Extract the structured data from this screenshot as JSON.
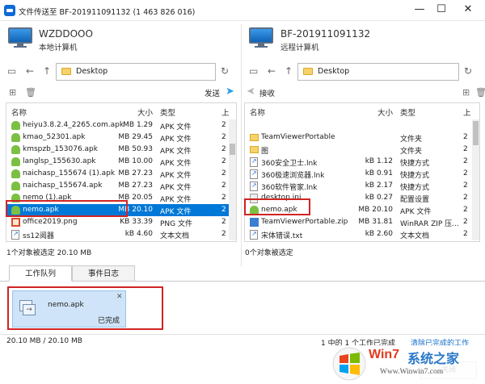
{
  "window": {
    "title": "文件传送至 BF-201911091132 (1 463 826 016)",
    "minimize": "—",
    "maximize": "☐",
    "close": "✕"
  },
  "local": {
    "name": "WZDDOOO",
    "subtitle": "本地计算机",
    "path": "Desktop",
    "send_label": "发送",
    "columns": {
      "name": "名称",
      "size": "大小",
      "type": "类型",
      "extra": "上"
    },
    "files": [
      {
        "name": "heiyu3.8.2.4_2265.com.apk",
        "size": "1.29 MB",
        "type": "APK 文件",
        "extra": "2",
        "icon": "apk"
      },
      {
        "name": "kmao_52301.apk",
        "size": "29.45 MB",
        "type": "APK 文件",
        "extra": "2",
        "icon": "apk"
      },
      {
        "name": "kmspzb_153076.apk",
        "size": "50.93 MB",
        "type": "APK 文件",
        "extra": "2",
        "icon": "apk"
      },
      {
        "name": "langlsp_155630.apk",
        "size": "10.00 MB",
        "type": "APK 文件",
        "extra": "2",
        "icon": "apk"
      },
      {
        "name": "naichasp_155674 (1).apk",
        "size": "27.23 MB",
        "type": "APK 文件",
        "extra": "2",
        "icon": "apk"
      },
      {
        "name": "naichasp_155674.apk",
        "size": "27.23 MB",
        "type": "APK 文件",
        "extra": "2",
        "icon": "apk"
      },
      {
        "name": "nemo (1).apk",
        "size": "20.05 MB",
        "type": "APK 文件",
        "extra": "2",
        "icon": "apk"
      },
      {
        "name": "nemo.apk",
        "size": "20.10 MB",
        "type": "APK 文件",
        "extra": "2",
        "icon": "apk"
      },
      {
        "name": "office2019.png",
        "size": "33.39 KB",
        "type": "PNG 文件",
        "extra": "2",
        "icon": "png"
      },
      {
        "name": "ss12阅器",
        "size": "4.60 kB",
        "type": "文本文档",
        "extra": "2",
        "icon": "lnk"
      }
    ],
    "status": "1个对象被选定  20.10 MB"
  },
  "remote": {
    "name": "BF-201911091132",
    "subtitle": "远程计算机",
    "path": "Desktop",
    "receive_label": "接收",
    "columns": {
      "name": "名称",
      "size": "大小",
      "type": "类型",
      "extra": "上"
    },
    "files": [
      {
        "name": "TeamViewerPortable",
        "size": "",
        "type": "文件夹",
        "extra": "2",
        "icon": "folder"
      },
      {
        "name": "图",
        "size": "",
        "type": "文件夹",
        "extra": "2",
        "icon": "folder"
      },
      {
        "name": "360安全卫士.lnk",
        "size": "1.12 kB",
        "type": "快捷方式",
        "extra": "2",
        "icon": "lnk"
      },
      {
        "name": "360极速浏览器.lnk",
        "size": "0.91 kB",
        "type": "快捷方式",
        "extra": "2",
        "icon": "lnk"
      },
      {
        "name": "360软件管家.lnk",
        "size": "2.17 kB",
        "type": "快捷方式",
        "extra": "2",
        "icon": "lnk"
      },
      {
        "name": "desktop.ini",
        "size": "0.27 kB",
        "type": "配置设置",
        "extra": "2",
        "icon": "ini"
      },
      {
        "name": "nemo.apk",
        "size": "20.10 MB",
        "type": "APK 文件",
        "extra": "2",
        "icon": "apk"
      },
      {
        "name": "TeamViewerPortable.zip",
        "size": "31.81 MB",
        "type": "WinRAR ZIP 压...",
        "extra": "2",
        "icon": "zip"
      },
      {
        "name": "宋体错误.txt",
        "size": "2.60 kB",
        "type": "文本文档",
        "extra": "2",
        "icon": "lnk"
      }
    ],
    "status": "0个对象被选定"
  },
  "tabs": [
    {
      "label": "工作队列"
    },
    {
      "label": "事件日志"
    }
  ],
  "job": {
    "name": "nemo.apk",
    "status": "已完成",
    "close": "✕"
  },
  "bottom": {
    "progress": "20.10 MB / 20.10 MB",
    "summary": "1 中的 1 个工作已完成",
    "clear_link": "清除已完成的工作",
    "close_label": "关闭"
  },
  "watermark": {
    "brand_a": "Win7",
    "brand_b": "系统之家",
    "url": "Www.Winwin7.com"
  },
  "colors": {
    "accent": "#0078d7",
    "highlight": "#d02424"
  }
}
